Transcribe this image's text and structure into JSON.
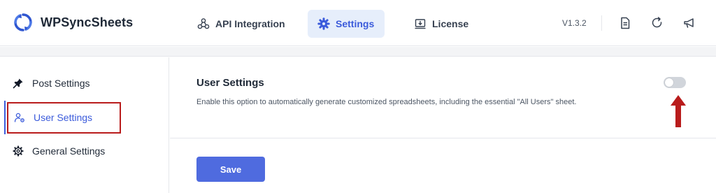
{
  "app": {
    "name": "WPSyncSheets",
    "version": "V1.3.2"
  },
  "nav": {
    "tabs": [
      {
        "label": "API Integration",
        "icon": "webhook-icon"
      },
      {
        "label": "Settings",
        "icon": "gear-icon",
        "active": true
      },
      {
        "label": "License",
        "icon": "license-download-icon"
      }
    ]
  },
  "toolbar": {
    "icons": [
      "document-icon",
      "refresh-icon",
      "megaphone-icon"
    ]
  },
  "sidebar": {
    "items": [
      {
        "label": "Post Settings",
        "icon": "pin-icon"
      },
      {
        "label": "User Settings",
        "icon": "user-settings-icon",
        "active": true
      },
      {
        "label": "General Settings",
        "icon": "gear-icon"
      }
    ]
  },
  "main": {
    "section_title": "User Settings",
    "section_description": "Enable this option to automatically generate customized spreadsheets, including the essential \"All Users\" sheet.",
    "toggle_on": false,
    "save_label": "Save"
  },
  "colors": {
    "accent": "#3b5bdb",
    "annotation": "#b91c1c",
    "save_button": "#4f6bdf"
  }
}
